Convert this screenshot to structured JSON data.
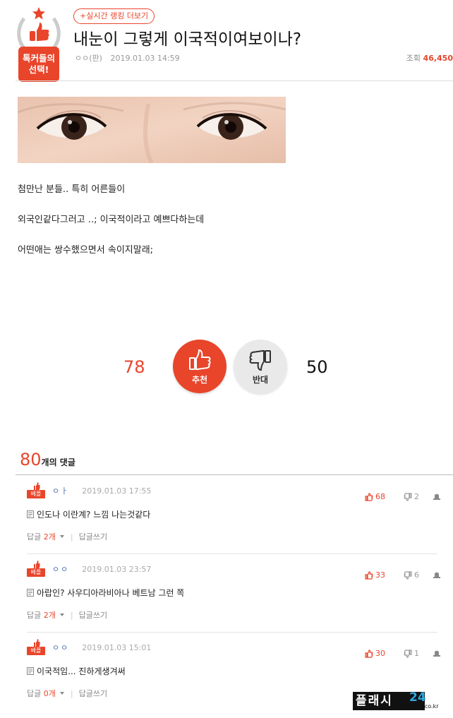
{
  "badge": {
    "line1": "톡커들의",
    "line2": "선택!"
  },
  "ranking_link": "+실시간 랭킹 더보기",
  "post": {
    "title": "내눈이 그렇게 이국적이여보이나?",
    "author": "ㅇㅇ(판)",
    "date": "2019.01.03 14:59",
    "views_label": "조회",
    "views_count": "46,450",
    "body": [
      "첨만난 분들.. 특히 어른들이",
      "외국인같다그러고 ..; 이국적이라고 예쁘다하는데",
      "어떤애는 쌍수했으면서 속이지말래;"
    ]
  },
  "vote": {
    "recommend_count": "78",
    "recommend_label": "추천",
    "oppose_label": "반대",
    "oppose_count": "50"
  },
  "comments_header": {
    "count": "80",
    "label": "개의 댓글"
  },
  "best_label": "베플",
  "comments": [
    {
      "author": "ㅇㅏ",
      "date": "2019.01.03 17:55",
      "likes": "68",
      "dislikes": "2",
      "text": "인도나 이란계? 느낌 나는것같다",
      "reply_label": "답글",
      "reply_count": "2개",
      "write_reply": "답글쓰기"
    },
    {
      "author": "ㅇㅇ",
      "date": "2019.01.03 23:57",
      "likes": "33",
      "dislikes": "6",
      "text": "아랍인? 사우디아라비아나 베트남 그런 쪽",
      "reply_label": "답글",
      "reply_count": "2개",
      "write_reply": "답글쓰기"
    },
    {
      "author": "ㅇㅇ",
      "date": "2019.01.03 15:01",
      "likes": "30",
      "dislikes": "1",
      "text": "이국적임... 진하게생겨써",
      "reply_label": "답글",
      "reply_count": "0개",
      "write_reply": "답글쓰기"
    }
  ],
  "watermark": {
    "main": "플래시",
    "num": "24",
    "url": "flash24.co.kr"
  },
  "colors": {
    "accent": "#e8452b",
    "author_blue": "#4a6fb5"
  }
}
